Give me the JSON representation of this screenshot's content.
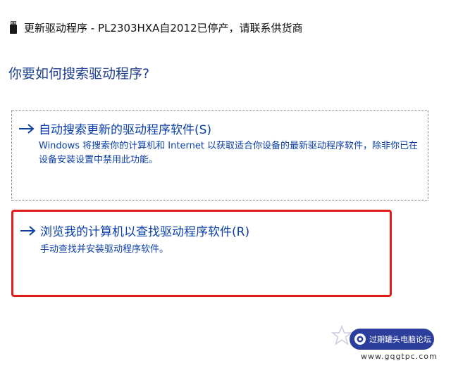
{
  "window": {
    "title": "更新驱动程序 - PL2303HXA自2012已停产，请联系供货商",
    "device_icon": "usb-device-icon"
  },
  "page": {
    "heading": "你要如何搜索驱动程序?"
  },
  "options": [
    {
      "label": "自动搜索更新的驱动程序软件(S)",
      "description": "Windows 将搜索你的计算机和 Internet 以获取适合你设备的最新驱动程序软件，除非你已在设备安装设置中禁用此功能。",
      "icon": "arrow-right-icon"
    },
    {
      "label": "浏览我的计算机以查找驱动程序软件(R)",
      "description": "手动查找并安装驱动程序软件。",
      "icon": "arrow-right-icon",
      "highlighted": true
    }
  ],
  "watermark": {
    "text": "过期罐头电脑论坛",
    "url": "www.gqgtpc.com"
  },
  "colors": {
    "heading": "#1f3f8f",
    "link": "#0b3fa8",
    "highlight_border": "#e31c1c",
    "watermark_bg": "#2c3e9c"
  }
}
